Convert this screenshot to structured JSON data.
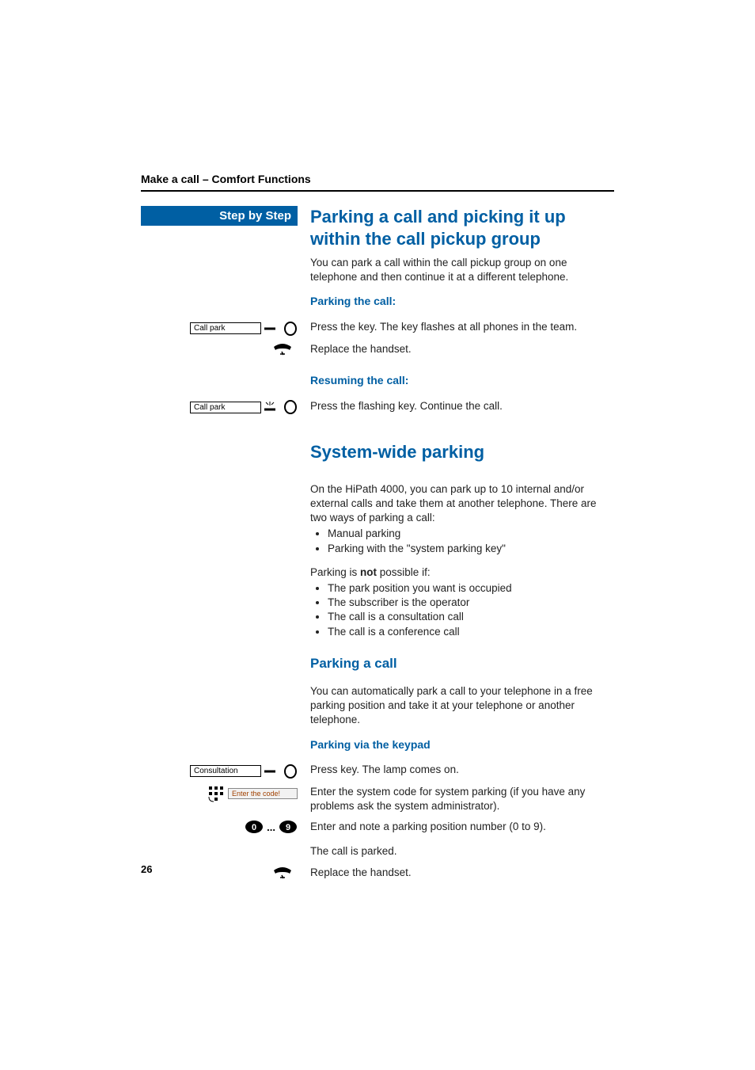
{
  "breadcrumb": "Make a call – Comfort Functions",
  "sidebar": {
    "step_header": "Step by Step"
  },
  "section1": {
    "title": "Parking a call and picking it up within the call pickup group",
    "intro": "You can park a call within the call pickup group on one telephone and then continue it at a different telephone.",
    "parking_heading": "Parking the call:",
    "resuming_heading": "Resuming the call:"
  },
  "section2": {
    "title": "System-wide parking",
    "intro": "On the HiPath 4000, you can park up to 10 internal and/or external calls and take them at another telephone. There are two ways of parking a call:",
    "ways": [
      "Manual parking",
      "Parking with the \"system parking key\""
    ],
    "not_possible_lead_pre": "Parking is ",
    "not_possible_lead_bold": "not",
    "not_possible_lead_post": " possible if:",
    "not_possible": [
      "The park position you want is occupied",
      "The subscriber is the operator",
      "The call is a consultation call",
      "The call is a conference call"
    ],
    "parking_a_call_heading": "Parking a call",
    "parking_a_call_body": "You can automatically park a call to your telephone in a free parking position and take it at your telephone or another telephone.",
    "via_keypad_heading": "Parking via the keypad"
  },
  "steps": {
    "call_park_key": "Call park",
    "press_key_flash": "Press the key. The key flashes at all phones in the team.",
    "replace_handset": "Replace the handset.",
    "press_flashing_continue": "Press the flashing key. Continue the call.",
    "consultation_key": "Consultation",
    "press_key_lamp": "Press key. The lamp comes on.",
    "enter_code_prompt": "Enter the code!",
    "enter_system_code": "Enter the system code for system parking (if you have any problems ask the system administrator).",
    "enter_position": "Enter and note a parking position number (0 to 9).",
    "call_parked": "The call is parked.",
    "digit_range_sep": "...",
    "digit0": "0",
    "digit9": "9"
  },
  "page_number": "26"
}
